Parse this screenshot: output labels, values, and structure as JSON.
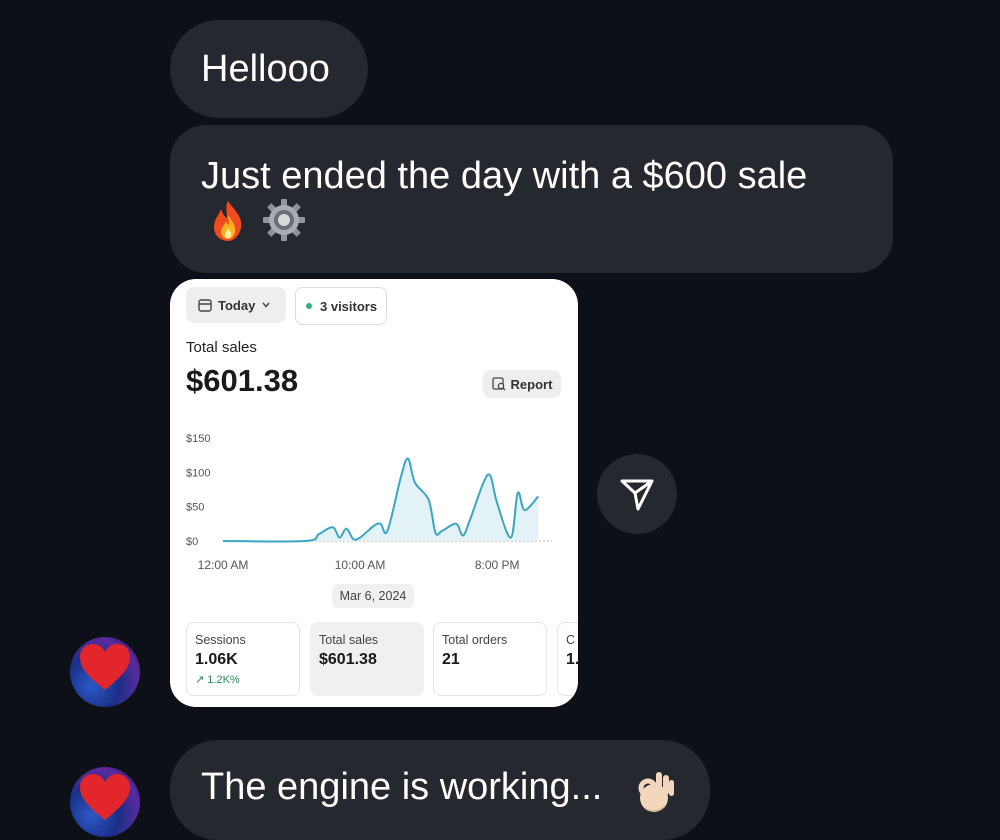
{
  "messages": {
    "greeting": "Hellooo",
    "sale_text": "Just ended the day with a $600 sale",
    "sale_emojis": [
      "fire",
      "gear"
    ],
    "engine_text": "The engine is working...",
    "engine_emoji": "ok-hand"
  },
  "card": {
    "period_label": "Today",
    "visitors_label": "3 visitors",
    "total_sales_label": "Total sales",
    "total_sales_value": "$601.38",
    "report_label": "Report",
    "date_label": "Mar 6, 2024",
    "stats": [
      {
        "label": "Sessions",
        "value": "1.06K",
        "change": "1.2K%"
      },
      {
        "label": "Total sales",
        "value": "$601.38"
      },
      {
        "label": "Total orders",
        "value": "21"
      },
      {
        "label": "C",
        "value": "1."
      }
    ]
  },
  "chart_data": {
    "type": "area",
    "y_ticks": [
      "$150",
      "$100",
      "$50",
      "$0"
    ],
    "x_ticks": [
      "12:00 AM",
      "10:00 AM",
      "8:00 PM"
    ],
    "ylim": [
      0,
      150
    ],
    "x_hours": [
      0,
      6,
      7,
      8,
      8.5,
      9,
      9.5,
      10,
      11,
      11.5,
      12,
      13,
      13.5,
      14,
      15,
      15.5,
      16,
      17,
      17.5,
      18,
      19,
      19.5,
      20,
      21,
      21.5,
      22,
      23
    ],
    "values": [
      0,
      0,
      10,
      20,
      5,
      18,
      3,
      5,
      22,
      25,
      15,
      95,
      120,
      85,
      60,
      12,
      15,
      25,
      8,
      30,
      85,
      95,
      55,
      5,
      70,
      45,
      65
    ],
    "colors": {
      "line": "#3aa6c4",
      "fill": "#e3f2f7",
      "zero_line": "#aaaaaa"
    }
  },
  "icons": {
    "share": "paper-plane-icon",
    "calendar": "calendar-icon",
    "report": "report-search-icon",
    "reaction": "heart-icon"
  }
}
